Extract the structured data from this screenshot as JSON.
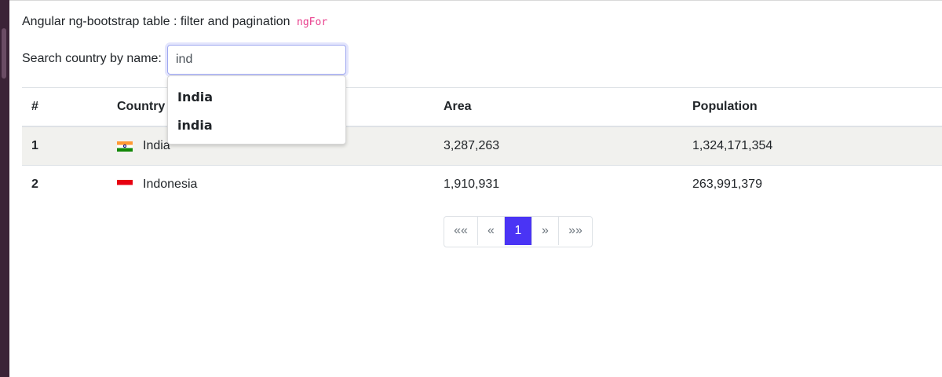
{
  "page": {
    "title": "Angular ng-bootstrap table : filter and pagination",
    "title_code": "ngFor"
  },
  "search": {
    "label": "Search country by name:",
    "value": "ind"
  },
  "typeahead": {
    "options": [
      "India",
      "india"
    ]
  },
  "table": {
    "columns": [
      "#",
      "Country",
      "Area",
      "Population"
    ],
    "rows": [
      {
        "num": "1",
        "flag": "india-flag-icon",
        "country": "India",
        "area": "3,287,263",
        "population": "1,324,171,354"
      },
      {
        "num": "2",
        "flag": "indonesia-flag-icon",
        "country": "Indonesia",
        "area": "1,910,931",
        "population": "263,991,379"
      }
    ]
  },
  "pagination": {
    "first": "««",
    "prev": "«",
    "current": "1",
    "next": "»",
    "last": "»»"
  },
  "colors": {
    "accent": "#4a34f5",
    "code": "#e83e8c",
    "stripe": "#f1f1ee",
    "border": "#dee2e6"
  }
}
